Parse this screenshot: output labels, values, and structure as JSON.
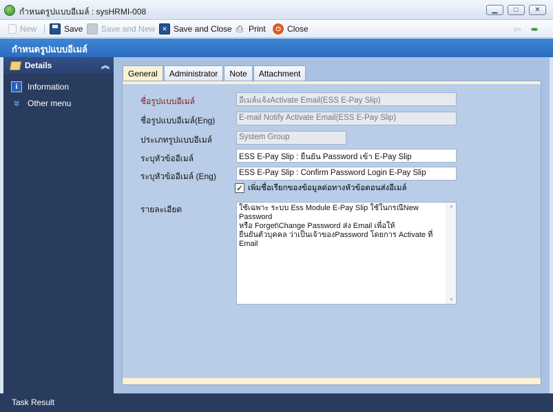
{
  "window": {
    "title": "กำหนดรูปแบบอีเมล์ : sysHRMI-008",
    "minimize_glyph": "▁",
    "maximize_glyph": "□",
    "close_glyph": "✕"
  },
  "toolbar": {
    "new_label": "New",
    "save_label": "Save",
    "save_and_new_label": "Save and New",
    "save_and_close_label": "Save and Close",
    "print_label": "Print",
    "close_label": "Close",
    "back_glyph": "⇦",
    "forward_glyph": "➨"
  },
  "page": {
    "title": "กำหนดรูปแบบอีเมล์"
  },
  "sidebar": {
    "header": "Details",
    "collapse_glyph": "︽",
    "items": [
      {
        "label": "Information",
        "icon": "info-icon",
        "glyph": "i"
      },
      {
        "label": "Other menu",
        "icon": "double-chevron-down-icon",
        "glyph": "»"
      }
    ]
  },
  "tabs": [
    {
      "label": "General",
      "active": true
    },
    {
      "label": "Administrator",
      "active": false
    },
    {
      "label": "Note",
      "active": false
    },
    {
      "label": "Attachment",
      "active": false
    }
  ],
  "form": {
    "template_name": {
      "label": "ชื่อรูปแบบอีเมล์",
      "value": "อีเมล์แจ้งActivate Email(ESS E-Pay Slip)"
    },
    "template_name_eng": {
      "label": "ชื่อรูปแบบอีเมล์(Eng)",
      "value": "E-mail Notify Activate Email(ESS E-Pay Slip)"
    },
    "template_type": {
      "label": "ประเภทรูปแบบอีเมล์",
      "value": "System Group"
    },
    "subject": {
      "label": "ระบุหัวข้ออีเมล์",
      "value": "ESS E-Pay Slip : ยืนยัน Password เข้า E-Pay Slip"
    },
    "subject_eng": {
      "label": "ระบุหัวข้ออีเมล์ (Eng)",
      "value": "ESS E-Pay Slip : Confirm Password Login E-Pay Slip"
    },
    "append_checkbox": {
      "label": "เพิ่มชื่อเรียกของข้อมูลต่อทางหัวข้อตอนส่งอีเมล์",
      "checked": true,
      "glyph": "✓"
    },
    "details": {
      "label": "รายละเอียด",
      "value": "ใช้เฉพาะ ระบบ Ess  Module E-Pay Slip ใช้ในกรณีNew Password\nหรือ Forget\\Change Password ส่ง Email เพื่อให้\nยืนยันตัวบุคคล ว่าเป็นเจ้าของPassword โดยการ Activate ที่ Email",
      "scroll_up_glyph": "▲",
      "scroll_down_glyph": "▼"
    }
  },
  "status": {
    "label": "Task Result"
  },
  "colors": {
    "page_title_bg": "#2f72c6",
    "sidebar_bg": "#293c5e",
    "panel_bg": "#b9cde8",
    "active_tab_bg": "#fbf1d4",
    "required_label": "#8b1a1a"
  }
}
